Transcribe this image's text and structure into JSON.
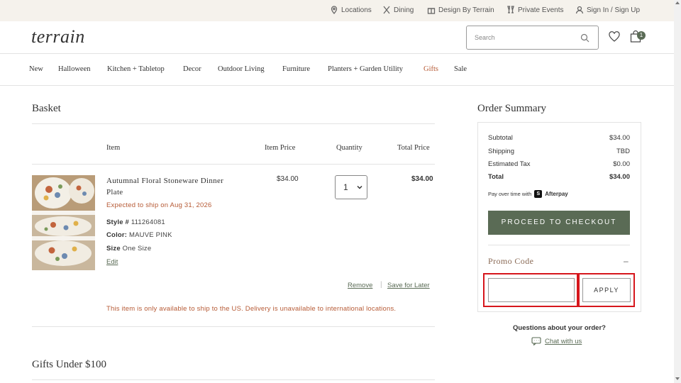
{
  "utility_bar": {
    "locations": "Locations",
    "dining": "Dining",
    "design": "Design By Terrain",
    "events": "Private Events",
    "signin": "Sign In / Sign Up"
  },
  "header": {
    "logo": "terrain",
    "search_placeholder": "Search",
    "cart_count": "1"
  },
  "nav": {
    "items": [
      "New",
      "Halloween",
      "Kitchen + Tabletop",
      "Decor",
      "Outdoor Living",
      "Furniture",
      "Planters + Garden Utility",
      "Gifts",
      "Sale"
    ],
    "active": "Gifts"
  },
  "basket": {
    "title": "Basket",
    "columns": {
      "item": "Item",
      "item_price": "Item Price",
      "quantity": "Quantity",
      "total_price": "Total Price"
    },
    "product": {
      "name": "Autumnal Floral Stoneware Dinner Plate",
      "ship_note": "Expected to ship on Aug 31, 2026",
      "style_label": "Style #",
      "style_value": "111264081",
      "color_label": "Color:",
      "color_value": "MAUVE PINK",
      "size_label": "Size",
      "size_value": "One Size",
      "edit": "Edit",
      "item_price": "$34.00",
      "quantity": "1",
      "total_price": "$34.00",
      "remove": "Remove",
      "save_for_later": "Save for Later",
      "international_note": "This item is only available to ship to the US. Delivery is unavailable to international locations."
    },
    "gifts_title": "Gifts Under $100"
  },
  "order_summary": {
    "title": "Order Summary",
    "rows": [
      {
        "label": "Subtotal",
        "value": "$34.00"
      },
      {
        "label": "Shipping",
        "value": "TBD"
      },
      {
        "label": "Estimated Tax",
        "value": "$0.00"
      },
      {
        "label": "Total",
        "value": "$34.00"
      }
    ],
    "afterpay_text": "Pay over time with",
    "afterpay_brand": "Afterpay",
    "checkout": "PROCEED TO CHECKOUT",
    "promo_label": "Promo Code",
    "promo_toggle": "–",
    "apply": "APPLY",
    "questions": "Questions about your order?",
    "chat": "Chat with us"
  },
  "colors": {
    "accent_green": "#5a6b55",
    "accent_orange": "#b65a35",
    "highlight_red": "#d6161c",
    "utility_bg": "#f5f2ec"
  }
}
